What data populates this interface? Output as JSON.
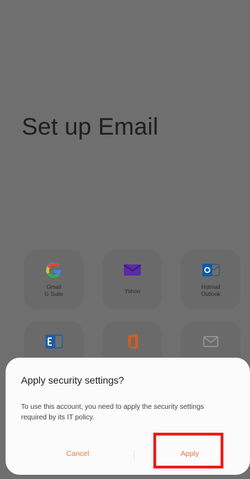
{
  "screen": {
    "title": "Set up Email"
  },
  "providers": [
    {
      "id": "gmail",
      "line1": "Gmail",
      "line2": "G Suite",
      "icon": "google-g-icon",
      "color": "#4285F4"
    },
    {
      "id": "yahoo",
      "line1": "Yahoo",
      "line2": "",
      "icon": "yahoo-envelope-icon",
      "color": "#5b2aa7"
    },
    {
      "id": "outlook",
      "line1": "Hotmail",
      "line2": "Outlook",
      "icon": "outlook-icon",
      "color": "#0f5aa6"
    },
    {
      "id": "exchange",
      "line1": "",
      "line2": "",
      "icon": "exchange-icon",
      "color": "#1b5fa6"
    },
    {
      "id": "office",
      "line1": "",
      "line2": "",
      "icon": "office-icon",
      "color": "#d45d1f"
    },
    {
      "id": "other",
      "line1": "",
      "line2": "",
      "icon": "mail-icon",
      "color": "#9a9a9a"
    }
  ],
  "dialog": {
    "title": "Apply security settings?",
    "message": "To use this account, you need to apply the security settings required by its IT policy.",
    "cancel_label": "Cancel",
    "apply_label": "Apply",
    "accent_color": "#e07a45"
  },
  "highlight": {
    "color": "#ef1b1b"
  }
}
